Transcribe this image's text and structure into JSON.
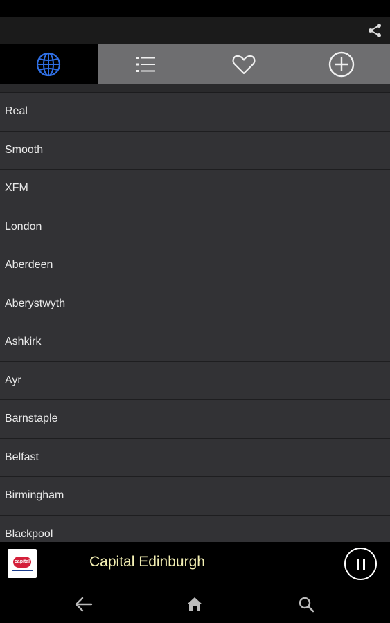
{
  "tabs": [
    {
      "name": "browse",
      "icon": "globe-icon",
      "active": true
    },
    {
      "name": "list",
      "icon": "list-icon",
      "active": false
    },
    {
      "name": "favorites",
      "icon": "heart-icon",
      "active": false
    },
    {
      "name": "add",
      "icon": "plus-circle-icon",
      "active": false
    }
  ],
  "stations": [
    "Real",
    "Smooth",
    "XFM",
    "London",
    "Aberdeen",
    "Aberystwyth",
    "Ashkirk",
    "Ayr",
    "Barnstaple",
    "Belfast",
    "Birmingham",
    "Blackpool"
  ],
  "player": {
    "station_name": "Capital Edinburgh",
    "logo_text": "capital"
  },
  "colors": {
    "globe": "#2f6fe4",
    "now_playing_text": "#f3efb3"
  }
}
